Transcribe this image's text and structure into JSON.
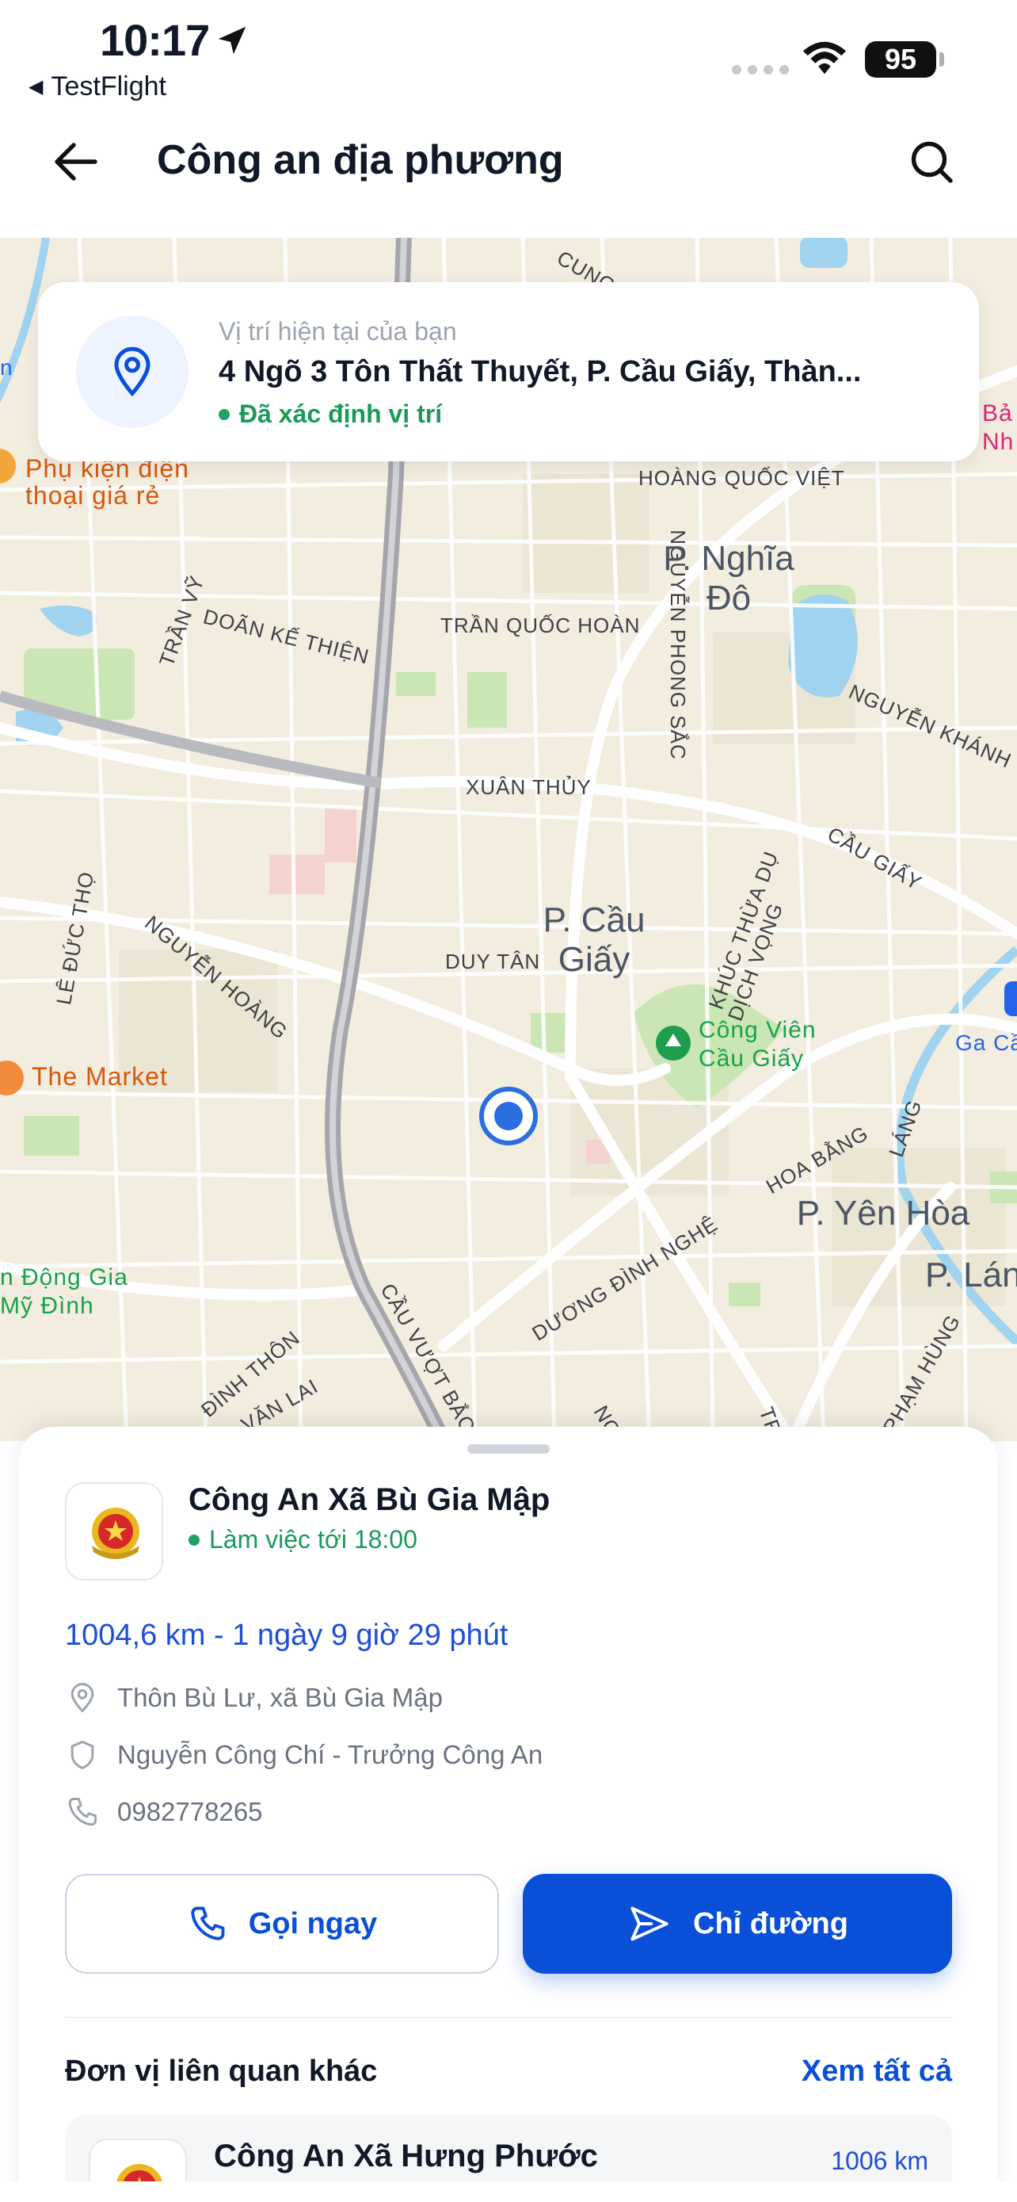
{
  "status_bar": {
    "time": "10:17",
    "back_app": "TestFlight",
    "battery": "95"
  },
  "header": {
    "title": "Công an địa phương",
    "back_icon": "arrow-left-icon",
    "search_icon": "search-icon"
  },
  "location_card": {
    "label": "Vị trí hiện tại của bạn",
    "address": "4 Ngõ 3 Tôn Thất Thuyết, P. Cầu Giấy, Thàn...",
    "status": "Đã xác định vị trí",
    "status_color": "#1b9a5a"
  },
  "map": {
    "streets": [
      "HOÀNG QUỐC VIỆT",
      "DOÃN KẾ THIỆN",
      "TRẦN QUỐC HOÀN",
      "XUÂN THỦY",
      "NGUYỄN PHONG SẮC",
      "NGUYỄN KHÁNH TOÀN",
      "CẦU GIẤY",
      "DUY TÂN",
      "KHÚC THỪA DỤ",
      "DỊCH VỌNG",
      "NGUYỄN HOÀNG",
      "LÊ ĐỨC THỌ",
      "TRẦN VỸ",
      "HOA BẰNG",
      "LÁNG",
      "DƯƠNG ĐÌNH NGHỆ",
      "ĐÌNH THÔN",
      "VĂN LAI",
      "CẦU VƯỢT BẮC",
      "PHẠM HÙNG",
      "CUNG",
      "NG",
      "TR"
    ],
    "areas": [
      "P. Nghĩa Đô",
      "P. Cầu Giấy",
      "P. Yên Hòa",
      "P. Lán"
    ],
    "pois": {
      "phu_kien": "Phụ kiện điện thoại giá rẻ",
      "the_market": "The Market",
      "cong_vien": "Công Viên Cầu Giấy",
      "ga_cau": "Ga Cầ",
      "van_dong": "n Động Gia Mỹ Đình",
      "bao_tang": "Bả Nh",
      "edge_n": "n"
    }
  },
  "station": {
    "name": "Công An Xã Bù Gia Mập",
    "hours": "Làm việc tới 18:00",
    "distance": "1004,6 km - 1 ngày 9 giờ 29 phút",
    "address": "Thôn Bù Lư, xã Bù Gia Mập",
    "head": "Nguyễn Công Chí - Trưởng Công An",
    "phone": "0982778265"
  },
  "actions": {
    "call": "Gọi ngay",
    "directions": "Chỉ đường",
    "primary_color": "#0a4fd8"
  },
  "related": {
    "title": "Đơn vị liên quan khác",
    "see_all": "Xem tất cả",
    "items": [
      {
        "name": "Công An Xã Hưng Phước",
        "distance": "1006 km"
      }
    ]
  }
}
